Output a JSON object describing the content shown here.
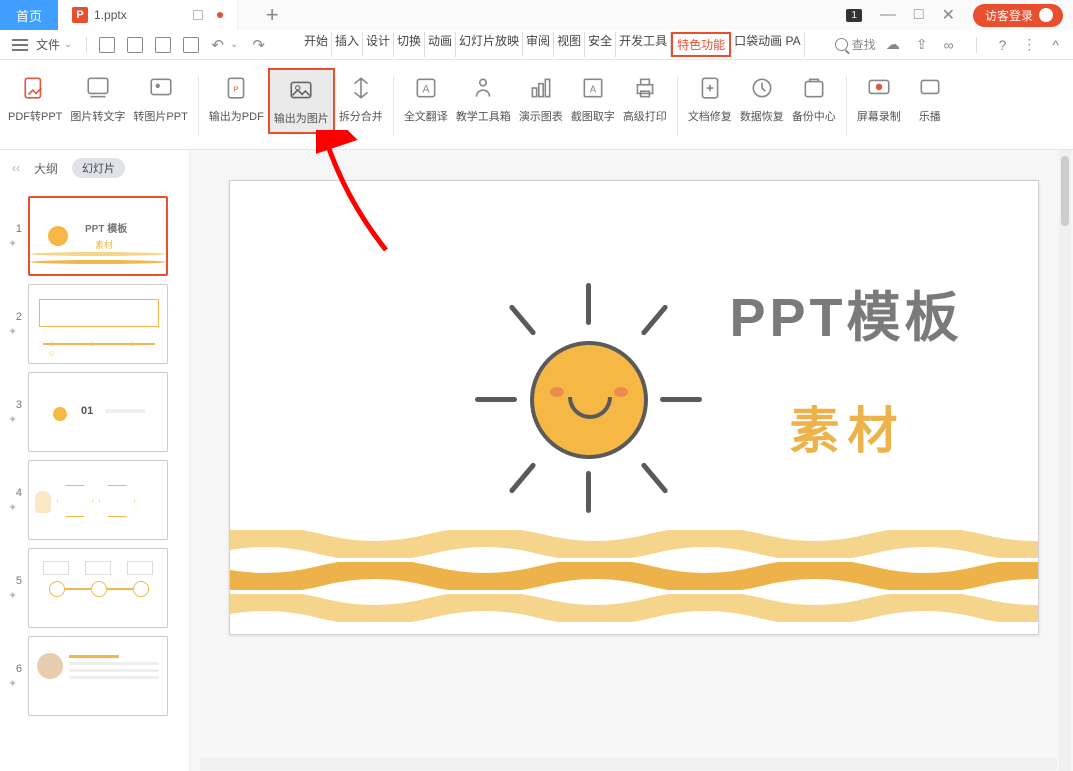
{
  "titlebar": {
    "home_tab": "首页",
    "file_tab": "1.pptx",
    "badge": "1",
    "login": "访客登录"
  },
  "quickbar": {
    "file_label": "文件",
    "menu_tabs": [
      "开始",
      "插入",
      "设计",
      "切换",
      "动画",
      "幻灯片放映",
      "审阅",
      "视图",
      "安全",
      "开发工具",
      "特色功能",
      "口袋动画 PA"
    ],
    "highlighted_tab": "特色功能",
    "search": "查找"
  },
  "ribbon": {
    "items": [
      "PDF转PPT",
      "图片转文字",
      "转图片PPT",
      "输出为PDF",
      "输出为图片",
      "拆分合并",
      "全文翻译",
      "教学工具箱",
      "演示图表",
      "截图取字",
      "高级打印",
      "文档修复",
      "数据恢复",
      "备份中心",
      "屏幕录制",
      "乐播"
    ],
    "highlighted": "输出为图片"
  },
  "sidebar": {
    "outline_label": "大纲",
    "slides_label": "幻灯片",
    "thumb1": {
      "t1": "PPT 模板",
      "t2": "素材"
    },
    "thumb3": {
      "num": "01"
    },
    "slide_numbers": [
      "1",
      "2",
      "3",
      "4",
      "5",
      "6"
    ]
  },
  "slide": {
    "title": "PPT模板",
    "subtitle": "素材"
  }
}
